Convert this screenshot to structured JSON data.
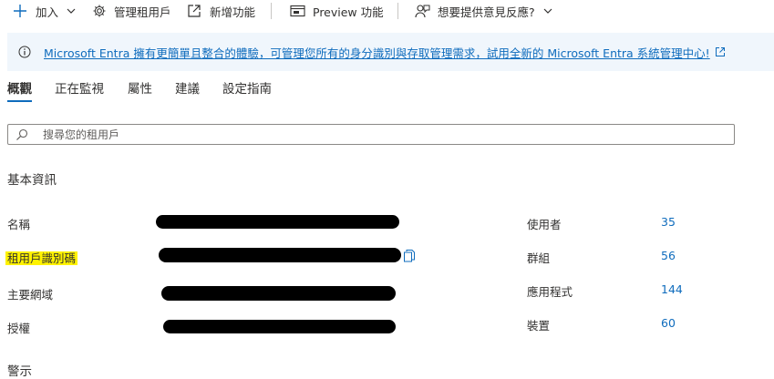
{
  "toolbar": {
    "add_label": "加入",
    "manage_tenants_label": "管理租用戶",
    "new_feature_label": "新增功能",
    "preview_feature_label": "Preview 功能",
    "feedback_label": "想要提供意見反應?"
  },
  "banner": {
    "text": "Microsoft Entra 擁有更簡單且整合的體驗，可管理您所有的身分識別與存取管理需求，試用全新的 Microsoft Entra 系統管理中心!"
  },
  "tabs": [
    {
      "label": "概觀",
      "active": true
    },
    {
      "label": "正在監視"
    },
    {
      "label": "屬性"
    },
    {
      "label": "建議"
    },
    {
      "label": "設定指南"
    }
  ],
  "search": {
    "placeholder": "搜尋您的租用戶"
  },
  "basic_info": {
    "title": "基本資訊",
    "properties": [
      {
        "label": "名稱"
      },
      {
        "label": "租用戶識別碼"
      },
      {
        "label": "主要網域"
      },
      {
        "label": "授權"
      }
    ],
    "stats": [
      {
        "label": "使用者",
        "value": "35"
      },
      {
        "label": "群組",
        "value": "56"
      },
      {
        "label": "應用程式",
        "value": "144"
      },
      {
        "label": "裝置",
        "value": "60"
      }
    ]
  },
  "alerts": {
    "title": "警示"
  },
  "colors": {
    "accent": "#0f6cbd",
    "highlight": "#fff200",
    "banner_bg": "#f0f6fc"
  }
}
